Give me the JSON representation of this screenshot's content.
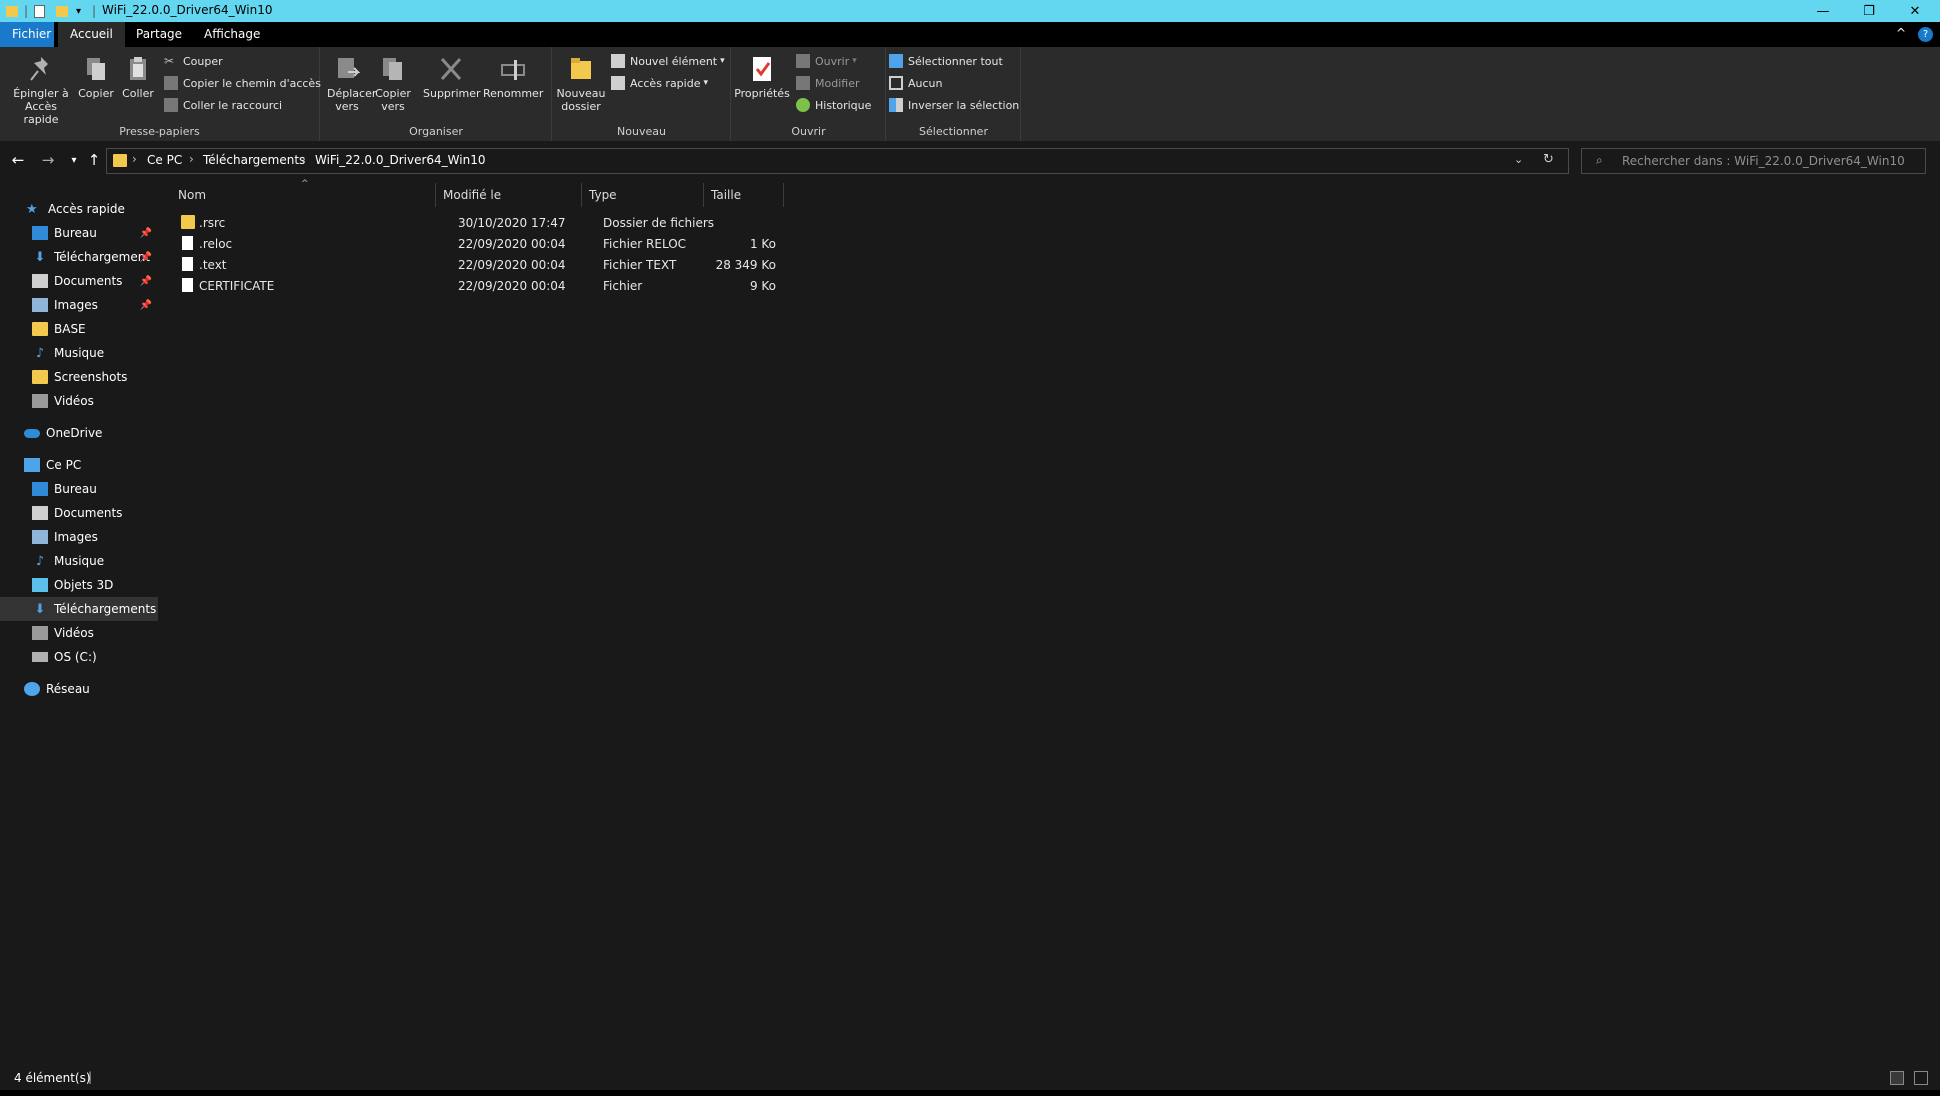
{
  "window": {
    "title": "WiFi_22.0.0_Driver64_Win10"
  },
  "tabs": [
    "Fichier",
    "Accueil",
    "Partage",
    "Affichage"
  ],
  "ribbon": {
    "clipboard": {
      "pin": "Épingler à Accès rapide",
      "copy": "Copier",
      "paste": "Coller",
      "cut": "Couper",
      "copy_path": "Copier le chemin d'accès",
      "paste_shortcut": "Coller le raccourci",
      "label": "Presse-papiers"
    },
    "organize": {
      "move": "Déplacer vers",
      "copyto": "Copier vers",
      "delete": "Supprimer",
      "rename": "Renommer",
      "label": "Organiser"
    },
    "new": {
      "folder": "Nouveau dossier",
      "new_item": "Nouvel élément",
      "easy_access": "Accès rapide",
      "label": "Nouveau"
    },
    "open": {
      "properties": "Propriétés",
      "open": "Ouvrir",
      "edit": "Modifier",
      "history": "Historique",
      "label": "Ouvrir"
    },
    "select": {
      "all": "Sélectionner tout",
      "none": "Aucun",
      "invert": "Inverser la sélection",
      "label": "Sélectionner"
    }
  },
  "address": {
    "crumbs": [
      "Ce PC",
      "Téléchargements",
      "WiFi_22.0.0_Driver64_Win10"
    ],
    "search_placeholder": "Rechercher dans : WiFi_22.0.0_Driver64_Win10"
  },
  "nav": {
    "quick": "Accès rapide",
    "quick_items": [
      "Bureau",
      "Téléchargements",
      "Documents",
      "Images",
      "BASE",
      "Musique",
      "Screenshots",
      "Vidéos"
    ],
    "onedrive": "OneDrive",
    "pc": "Ce PC",
    "pc_items": [
      "Bureau",
      "Documents",
      "Images",
      "Musique",
      "Objets 3D",
      "Téléchargements",
      "Vidéos",
      "OS (C:)"
    ],
    "network": "Réseau"
  },
  "columns": [
    "Nom",
    "Modifié le",
    "Type",
    "Taille"
  ],
  "files": [
    {
      "name": ".rsrc",
      "modified": "30/10/2020 17:47",
      "type": "Dossier de fichiers",
      "size": ""
    },
    {
      "name": ".reloc",
      "modified": "22/09/2020 00:04",
      "type": "Fichier RELOC",
      "size": "1 Ko"
    },
    {
      "name": ".text",
      "modified": "22/09/2020 00:04",
      "type": "Fichier TEXT",
      "size": "28 349 Ko"
    },
    {
      "name": "CERTIFICATE",
      "modified": "22/09/2020 00:04",
      "type": "Fichier",
      "size": "9 Ko"
    }
  ],
  "status": {
    "count": "4 élément(s)"
  },
  "colors": {
    "titlebar": "#63d7f0",
    "file_tab": "#1979ca",
    "background": "#191919",
    "ribbon": "#2b2b2b"
  }
}
